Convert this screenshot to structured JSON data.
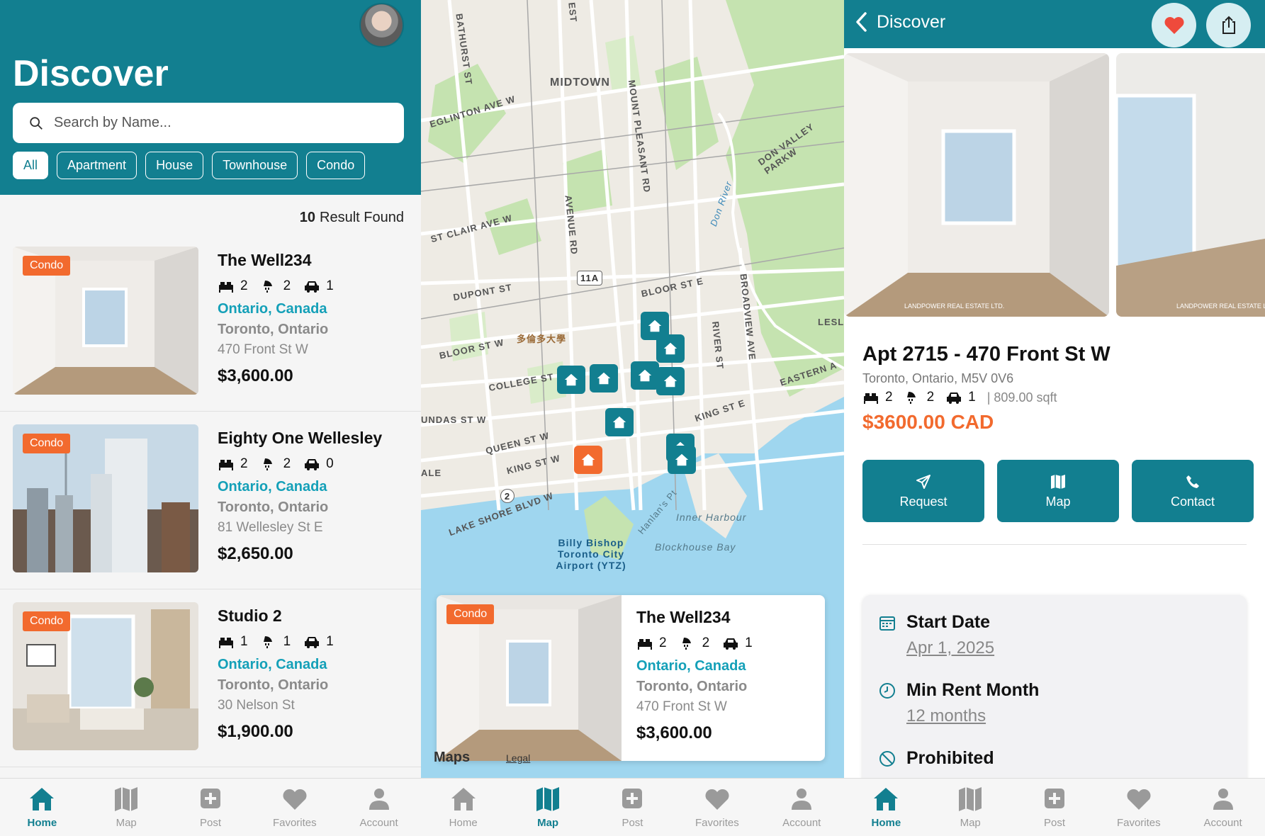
{
  "screen1": {
    "title": "Discover",
    "search_placeholder": "Search by Name...",
    "filters": [
      "All",
      "Apartment",
      "House",
      "Townhouse",
      "Condo"
    ],
    "results_count": "10",
    "results_label": "Result Found",
    "listings": [
      {
        "tag": "Condo",
        "name": "The Well234",
        "beds": "2",
        "baths": "2",
        "parking": "1",
        "region": "Ontario, Canada",
        "city": "Toronto, Ontario",
        "address": "470 Front St W",
        "price": "$3,600.00"
      },
      {
        "tag": "Condo",
        "name": "Eighty One Wellesley",
        "beds": "2",
        "baths": "2",
        "parking": "0",
        "region": "Ontario, Canada",
        "city": "Toronto, Ontario",
        "address": "81 Wellesley St E",
        "price": "$2,650.00"
      },
      {
        "tag": "Condo",
        "name": "Studio 2",
        "beds": "1",
        "baths": "1",
        "parking": "1",
        "region": "Ontario, Canada",
        "city": "Toronto, Ontario",
        "address": "30 Nelson St",
        "price": "$1,900.00"
      }
    ]
  },
  "screen2": {
    "map_labels": {
      "midtown": "MIDTOWN",
      "eglinton": "EGLINTON AVE W",
      "stclair": "ST CLAIR AVE W",
      "dupont": "DUPONT ST",
      "bloor_w": "BLOOR ST W",
      "bloor_e": "BLOOR ST E",
      "college": "COLLEGE ST",
      "queen": "QUEEN ST W",
      "king_w": "KING ST W",
      "king_e": "KING ST E",
      "dundas": "UNDAS ST W",
      "lakeshore": "LAKE SHORE BLVD W",
      "bathurst": "BATHURST ST",
      "avenue": "AVENUE RD",
      "mountpleasant": "MOUNT PLEASANT RD",
      "donvalley": "DON VALLEY PARKW",
      "broadview": "BROADVIEW AVE",
      "river": "RIVER ST",
      "eastern": "EASTERN A",
      "leslie": "LESLI",
      "university": "多倫多大學",
      "airport": "Billy Bishop Toronto City Airport (YTZ)",
      "inner_harbour": "Inner Harbour",
      "blockhouse": "Blockhouse Bay",
      "hanlans": "Hanlan's Pt",
      "don_river": "Don River",
      "route11a": "11A",
      "route2": "2",
      "ale": "ALE",
      "est": "EST"
    },
    "maps_attribution": "Maps",
    "legal": "Legal",
    "card": {
      "tag": "Condo",
      "name": "The Well234",
      "beds": "2",
      "baths": "2",
      "parking": "1",
      "region": "Ontario, Canada",
      "city": "Toronto, Ontario",
      "address": "470 Front St W",
      "price": "$3,600.00"
    }
  },
  "screen3": {
    "back_label": "Discover",
    "title": "Apt 2715 - 470 Front St W",
    "address": "Toronto, Ontario, M5V 0V6",
    "beds": "2",
    "baths": "2",
    "parking": "1",
    "sqft": "| 809.00 sqft",
    "price": "$3600.00 CAD",
    "actions": [
      "Request",
      "Map",
      "Contact"
    ],
    "start_date_label": "Start Date",
    "start_date_value": "Apr 1, 2025",
    "min_rent_label": "Min Rent Month",
    "min_rent_value": "12 months",
    "prohibited_label": "Prohibited",
    "photo_watermark": "LANDPOWER REAL ESTATE LTD."
  },
  "tabbar": [
    "Home",
    "Map",
    "Post",
    "Favorites",
    "Account"
  ],
  "colors": {
    "brand": "#127f90",
    "accent": "#f26a2e",
    "link": "#14a0b8"
  }
}
